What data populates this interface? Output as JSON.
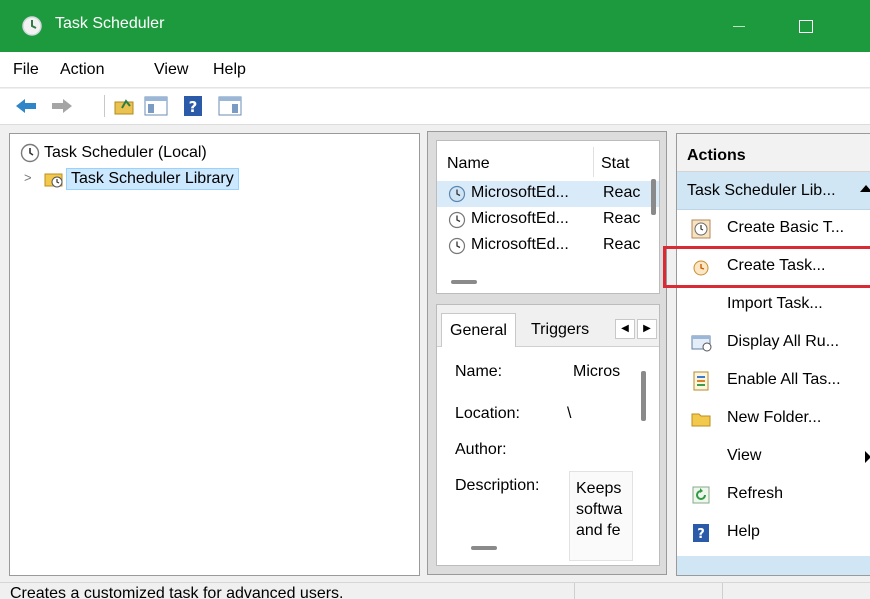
{
  "window": {
    "title": "Task Scheduler",
    "accent": "#1e9a3e"
  },
  "menu": {
    "file": "File",
    "action": "Action",
    "view": "View",
    "help": "Help"
  },
  "toolbar": {
    "icons": [
      "back-arrow-icon",
      "forward-arrow-icon",
      "up-folder-icon",
      "show-hide-console-tree-icon",
      "help-icon",
      "show-hide-action-pane-icon"
    ]
  },
  "tree": {
    "root_label": "Task Scheduler (Local)",
    "library_label": "Task Scheduler Library"
  },
  "task_list": {
    "columns": [
      "Name",
      "Stat"
    ],
    "rows": [
      {
        "name": "MicrosoftEd...",
        "status": "Reac"
      },
      {
        "name": "MicrosoftEd...",
        "status": "Reac"
      },
      {
        "name": "MicrosoftEd...",
        "status": "Reac"
      }
    ]
  },
  "details": {
    "tabs": [
      "General",
      "Triggers"
    ],
    "name_label": "Name:",
    "name_value": "Micros",
    "location_label": "Location:",
    "location_value": "\\",
    "author_label": "Author:",
    "description_label": "Description:",
    "description_value": "Keeps softwa and fe"
  },
  "actions": {
    "header": "Actions",
    "section": "Task Scheduler Lib...",
    "items": [
      {
        "label": "Create Basic T...",
        "icon": "create-basic-task-icon"
      },
      {
        "label": "Create Task...",
        "icon": "create-task-icon"
      },
      {
        "label": "Import Task...",
        "icon": ""
      },
      {
        "label": "Display All Ru...",
        "icon": "display-running-tasks-icon"
      },
      {
        "label": "Enable All Tas...",
        "icon": "enable-history-icon"
      },
      {
        "label": "New Folder...",
        "icon": "new-folder-icon"
      },
      {
        "label": "View",
        "icon": ""
      },
      {
        "label": "Refresh",
        "icon": "refresh-icon"
      },
      {
        "label": "Help",
        "icon": "help-icon"
      }
    ],
    "highlight_color": "#d92b35"
  },
  "status": {
    "text": "Creates a customized task for advanced users."
  }
}
